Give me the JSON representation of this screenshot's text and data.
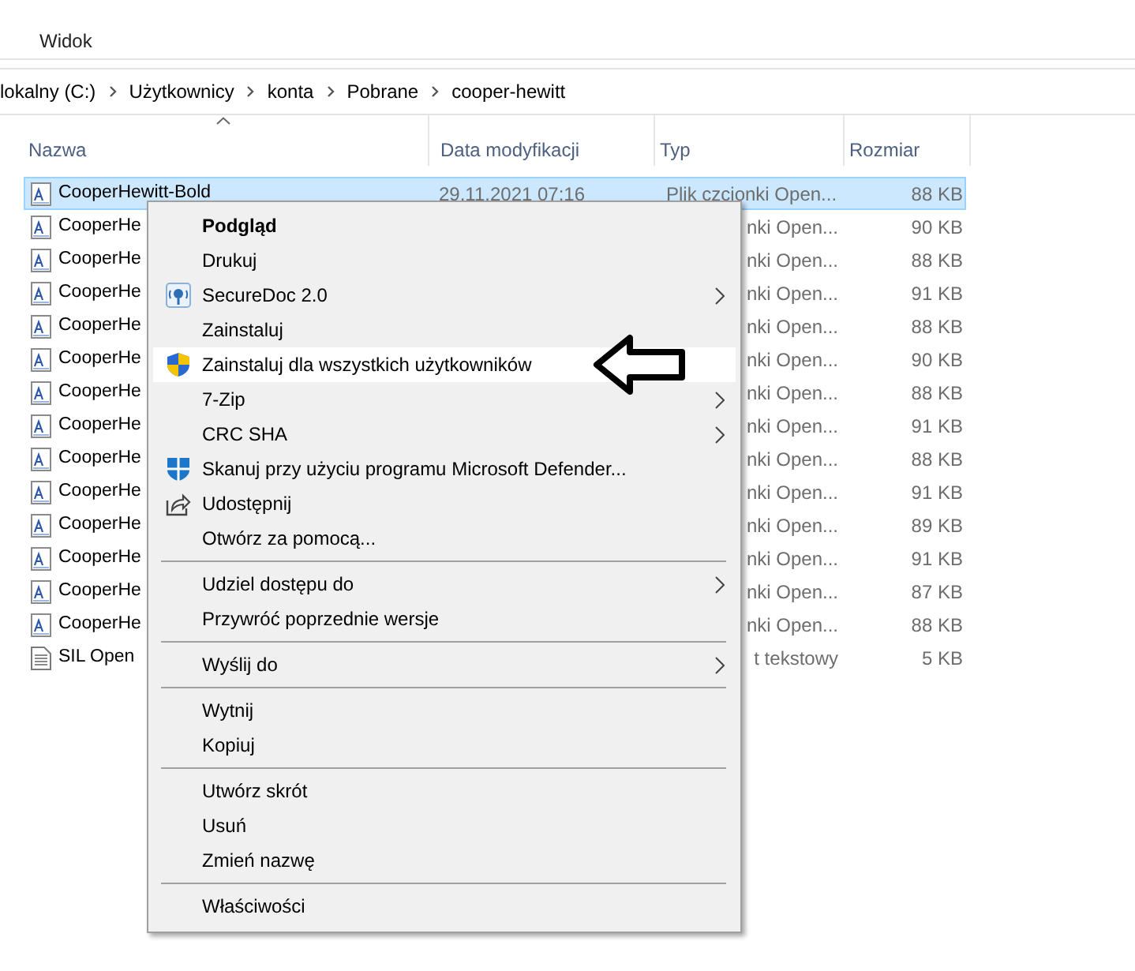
{
  "ribbon": {
    "tabs": [
      "Widok"
    ]
  },
  "address_bar": {
    "path": [
      "lokalny (C:)",
      "Użytkownicy",
      "konta",
      "Pobrane",
      "cooper-hewitt"
    ]
  },
  "file_list": {
    "columns": [
      "Nazwa",
      "Data modyfikacji",
      "Typ",
      "Rozmiar"
    ],
    "rows": [
      {
        "kind": "font",
        "name": "CooperHewitt-Bold",
        "date": "29.11.2021 07:16",
        "type": "Plik czcionki Open...",
        "size": "88 KB",
        "selected": true
      },
      {
        "kind": "font",
        "name": "CooperHe",
        "type": "nki Open...",
        "size": "90 KB",
        "selected": false
      },
      {
        "kind": "font",
        "name": "CooperHe",
        "type": "nki Open...",
        "size": "88 KB",
        "selected": false
      },
      {
        "kind": "font",
        "name": "CooperHe",
        "type": "nki Open...",
        "size": "91 KB",
        "selected": false
      },
      {
        "kind": "font",
        "name": "CooperHe",
        "type": "nki Open...",
        "size": "88 KB",
        "selected": false
      },
      {
        "kind": "font",
        "name": "CooperHe",
        "type": "nki Open...",
        "size": "90 KB",
        "selected": false
      },
      {
        "kind": "font",
        "name": "CooperHe",
        "type": "nki Open...",
        "size": "88 KB",
        "selected": false
      },
      {
        "kind": "font",
        "name": "CooperHe",
        "type": "nki Open...",
        "size": "91 KB",
        "selected": false
      },
      {
        "kind": "font",
        "name": "CooperHe",
        "type": "nki Open...",
        "size": "88 KB",
        "selected": false
      },
      {
        "kind": "font",
        "name": "CooperHe",
        "type": "nki Open...",
        "size": "91 KB",
        "selected": false
      },
      {
        "kind": "font",
        "name": "CooperHe",
        "type": "nki Open...",
        "size": "89 KB",
        "selected": false
      },
      {
        "kind": "font",
        "name": "CooperHe",
        "type": "nki Open...",
        "size": "91 KB",
        "selected": false
      },
      {
        "kind": "font",
        "name": "CooperHe",
        "type": "nki Open...",
        "size": "87 KB",
        "selected": false
      },
      {
        "kind": "font",
        "name": "CooperHe",
        "type": "nki Open...",
        "size": "88 KB",
        "selected": false
      },
      {
        "kind": "text",
        "name": "SIL Open",
        "type": "t tekstowy",
        "size": "5 KB",
        "selected": false
      }
    ]
  },
  "context_menu": {
    "items": [
      {
        "kind": "item",
        "label": "Podgląd",
        "default": true,
        "submenu": false,
        "selected": false
      },
      {
        "kind": "item",
        "label": "Drukuj",
        "default": false,
        "submenu": false,
        "selected": false
      },
      {
        "kind": "item",
        "label": "SecureDoc 2.0",
        "default": false,
        "submenu": true,
        "selected": false
      },
      {
        "kind": "item",
        "label": "Zainstaluj",
        "default": false,
        "submenu": false,
        "selected": false
      },
      {
        "kind": "item",
        "label": "Zainstaluj dla wszystkich użytkowników",
        "default": false,
        "submenu": false,
        "selected": true
      },
      {
        "kind": "item",
        "label": "7-Zip",
        "default": false,
        "submenu": true,
        "selected": false
      },
      {
        "kind": "item",
        "label": "CRC SHA",
        "default": false,
        "submenu": true,
        "selected": false
      },
      {
        "kind": "item",
        "label": "Skanuj przy użyciu programu Microsoft Defender...",
        "default": false,
        "submenu": false,
        "selected": false
      },
      {
        "kind": "item",
        "label": "Udostępnij",
        "default": false,
        "submenu": false,
        "selected": false
      },
      {
        "kind": "item",
        "label": "Otwórz za pomocą...",
        "default": false,
        "submenu": false,
        "selected": false
      },
      {
        "kind": "separator"
      },
      {
        "kind": "item",
        "label": "Udziel dostępu do",
        "default": false,
        "submenu": true,
        "selected": false
      },
      {
        "kind": "item",
        "label": "Przywróć poprzednie wersje",
        "default": false,
        "submenu": false,
        "selected": false
      },
      {
        "kind": "separator"
      },
      {
        "kind": "item",
        "label": "Wyślij do",
        "default": false,
        "submenu": true,
        "selected": false
      },
      {
        "kind": "separator"
      },
      {
        "kind": "item",
        "label": "Wytnij",
        "default": false,
        "submenu": false,
        "selected": false
      },
      {
        "kind": "item",
        "label": "Kopiuj",
        "default": false,
        "submenu": false,
        "selected": false
      },
      {
        "kind": "separator"
      },
      {
        "kind": "item",
        "label": "Utwórz skrót",
        "default": false,
        "submenu": false,
        "selected": false
      },
      {
        "kind": "item",
        "label": "Usuń",
        "default": false,
        "submenu": false,
        "selected": false
      },
      {
        "kind": "item",
        "label": "Zmień nazwę",
        "default": false,
        "submenu": false,
        "selected": false
      },
      {
        "kind": "separator"
      },
      {
        "kind": "item",
        "label": "Właściwości",
        "default": false,
        "submenu": false,
        "selected": false
      }
    ]
  }
}
